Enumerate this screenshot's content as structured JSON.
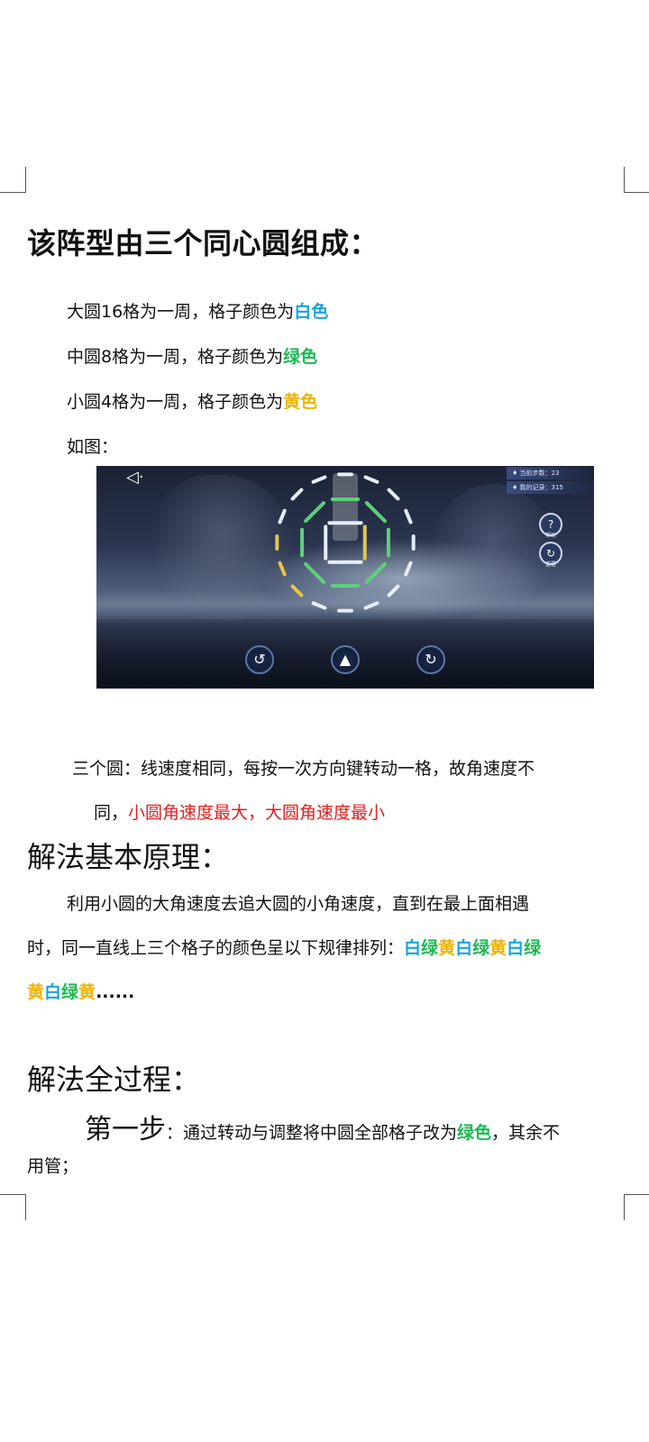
{
  "heading": "该阵型由三个同心圆组成：",
  "circles": {
    "big_prefix": "大圆16格为一周，格子颜色为",
    "big_color": "白色",
    "mid_prefix": "中圆8格为一周，格子颜色为",
    "mid_color": "绿色",
    "small_prefix": "小圆4格为一周，格子颜色为",
    "small_color": "黄色",
    "as_shown": "如图："
  },
  "game": {
    "back_icon": "◁·",
    "current_steps": "♦ 当前步数：23",
    "my_record": "♦ 我的记录：315",
    "help_label": "帮助",
    "reset_label": "重置",
    "colors": {
      "white": "#e6eef8",
      "green": "#5fcf7a",
      "yellow": "#e8c24a"
    }
  },
  "speed": {
    "line1": "三个圆：线速度相同，每按一次方向键转动一格，故角速度不",
    "line2_prefix": "同，",
    "line2_red": "小圆角速度最大，大圆角速度最小"
  },
  "principle": {
    "title": "解法基本原理：",
    "line1": "利用小圆的大角速度去追大圆的小角速度，直到在最上面相遇",
    "line2_prefix": "时，同一直线上三个格子的颜色呈以下规律排列：",
    "p": [
      "白",
      "绿",
      "黄",
      "白",
      "绿",
      "黄",
      "白",
      "绿"
    ],
    "p2": [
      "黄",
      "白",
      "绿",
      "黄"
    ],
    "ellipsis": "......"
  },
  "process": {
    "title": "解法全过程：",
    "step_label": "第一步",
    "step_text": "：通过转动与调整将中圆全部格子改为",
    "step_green": "绿色",
    "step_rest": "，其余不",
    "line2": "用管；"
  }
}
